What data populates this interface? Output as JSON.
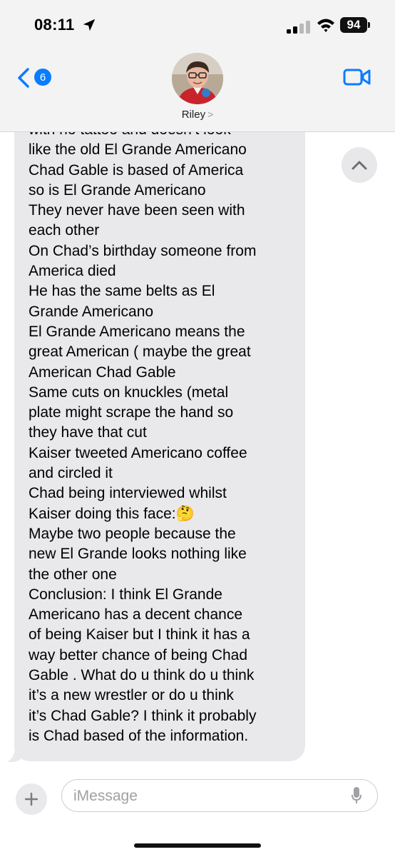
{
  "status_bar": {
    "time": "08:11",
    "battery": "94"
  },
  "header": {
    "back_badge_count": "6",
    "contact_name": "Riley",
    "name_chevron": ">"
  },
  "message": {
    "text": "with no tattoo and doesn’t look\nlike the old El Grande Americano\nChad Gable is based of America\nso is El Grande Americano\nThey never have been seen with\neach other\nOn Chad’s birthday someone from\nAmerica died\nHe has the same belts as El\nGrande Americano\nEl Grande Americano means the\ngreat American ( maybe the great\nAmerican Chad Gable\nSame cuts on knuckles (metal\nplate might scrape the hand so\nthey have that cut\nKaiser tweeted Americano coffee\nand circled it\nChad being interviewed whilst\nKaiser doing this face:🤔\nMaybe two people because the\nnew El Grande looks nothing like\nthe other one\nConclusion: I think El Grande\nAmericano has a decent chance\nof being Kaiser but I think it has a\nway better chance of being Chad\nGable . What do u think do u think\nit’s a new wrestler or do u think\nit’s Chad Gable? I think it probably\nis Chad based of the information."
  },
  "composer": {
    "placeholder": "iMessage"
  },
  "colors": {
    "accent": "#0a7cff",
    "received_bubble": "#e9e9eb",
    "header_bg": "#f3f3f4"
  },
  "icons": [
    "location-arrow-icon",
    "signal-icon",
    "wifi-icon",
    "battery-icon",
    "back-chevron-icon",
    "video-call-icon",
    "chevron-up-icon",
    "plus-icon",
    "microphone-icon"
  ]
}
